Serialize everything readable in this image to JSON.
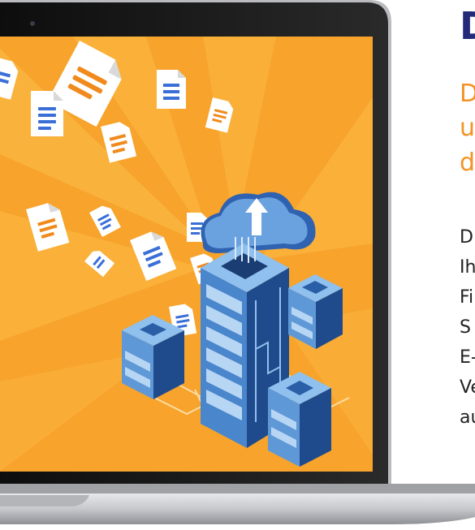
{
  "illustration": {
    "subject": "laptop-with-cloud-server",
    "colors": {
      "screen_orange": "#f7a32c",
      "ray_light": "#fcc14a",
      "document_paper": "#ffffff",
      "document_fold": "#d9d9d9",
      "document_lines_blue": "#3a6fd8",
      "document_lines_orange": "#f08a1c",
      "server_dark": "#1f4b8c",
      "server_light": "#5f98d6",
      "cloud": "#3d74c4",
      "laptop_bezel": "#111111",
      "laptop_body": "#c9cbcf"
    }
  },
  "text_panel": {
    "heading_fragment": "D",
    "subheading_fragments": [
      "D",
      "u",
      "d"
    ],
    "body_fragments": [
      "D",
      "Ih",
      "Fi",
      "S",
      "E-",
      "Ve",
      "au"
    ]
  }
}
